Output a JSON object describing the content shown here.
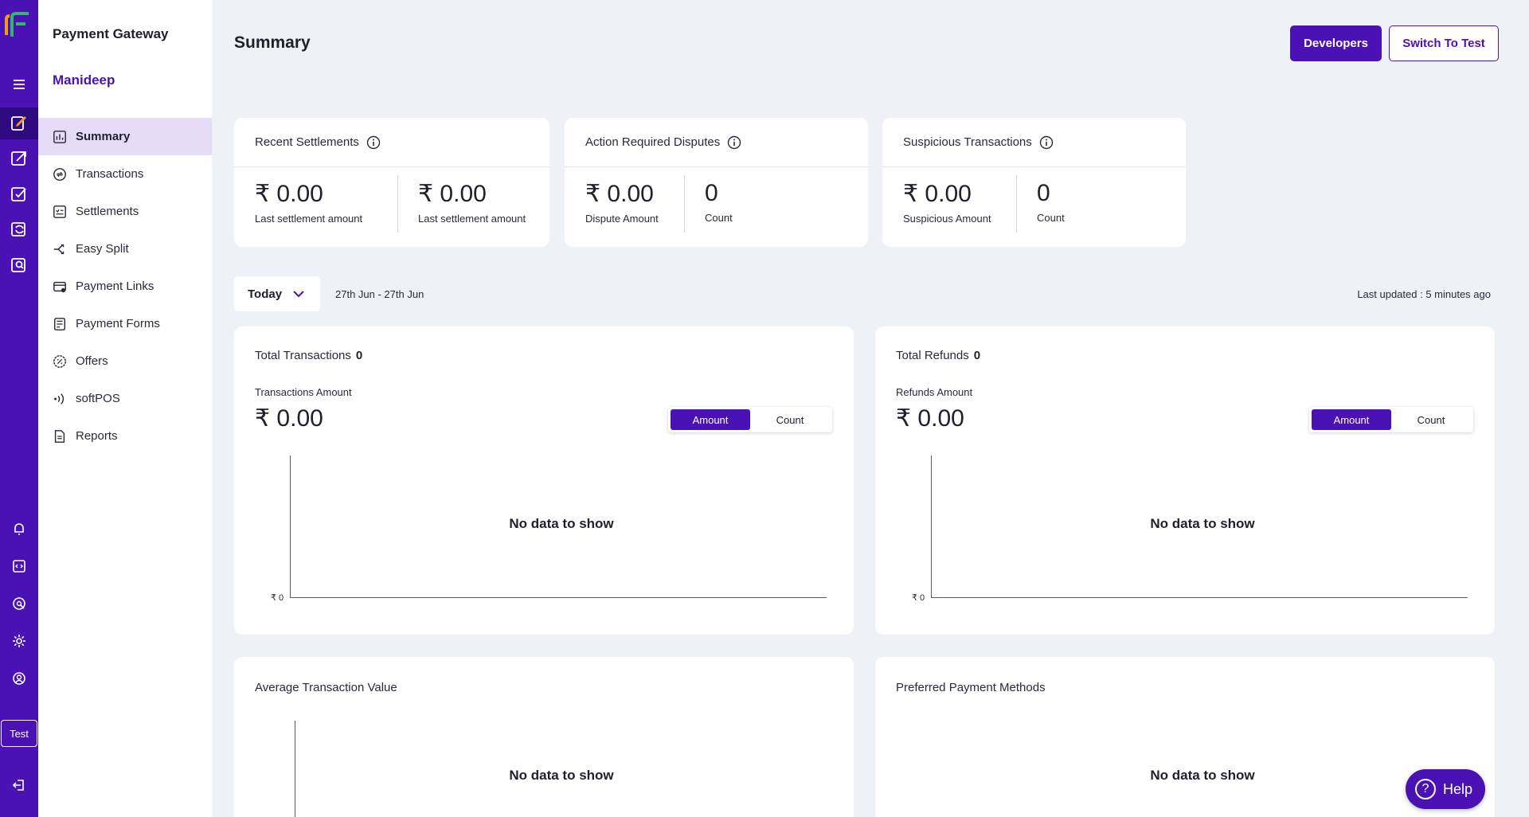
{
  "sidebar": {
    "title": "Payment Gateway",
    "user": "Manideep",
    "items": [
      {
        "label": "Summary",
        "icon": "bar-chart-icon"
      },
      {
        "label": "Transactions",
        "icon": "transactions-icon"
      },
      {
        "label": "Settlements",
        "icon": "settlements-icon"
      },
      {
        "label": "Easy Split",
        "icon": "split-icon"
      },
      {
        "label": "Payment Links",
        "icon": "card-link-icon"
      },
      {
        "label": "Payment Forms",
        "icon": "form-icon"
      },
      {
        "label": "Offers",
        "icon": "offer-badge-icon"
      },
      {
        "label": "softPOS",
        "icon": "nfc-icon"
      },
      {
        "label": "Reports",
        "icon": "document-icon"
      }
    ]
  },
  "rail": {
    "test_label": "Test"
  },
  "header": {
    "title": "Summary",
    "developers_label": "Developers",
    "switch_label": "Switch To Test"
  },
  "stats": {
    "settlements": {
      "title": "Recent Settlements",
      "cells": [
        {
          "value": "₹ 0.00",
          "label": "Last settlement amount"
        },
        {
          "value": "₹ 0.00",
          "label": "Last settlement amount"
        }
      ]
    },
    "disputes": {
      "title": "Action Required Disputes",
      "cells": [
        {
          "value": "₹ 0.00",
          "label": "Dispute Amount"
        },
        {
          "value": "0",
          "label": "Count"
        }
      ]
    },
    "suspicious": {
      "title": "Suspicious Transactions",
      "cells": [
        {
          "value": "₹ 0.00",
          "label": "Suspicious Amount"
        },
        {
          "value": "0",
          "label": "Count"
        }
      ]
    }
  },
  "filter": {
    "period": "Today",
    "date_range": "27th Jun - 27th Jun",
    "last_updated": "Last updated : 5 minutes ago"
  },
  "charts": {
    "transactions": {
      "title": "Total Transactions",
      "total": "0",
      "sub": "Transactions Amount",
      "amount": "₹ 0.00",
      "toggle_on": "Amount",
      "toggle_off": "Count",
      "empty": "No data to show",
      "zero_tick": "₹ 0"
    },
    "refunds": {
      "title": "Total Refunds",
      "total": "0",
      "sub": "Refunds Amount",
      "amount": "₹ 0.00",
      "toggle_on": "Amount",
      "toggle_off": "Count",
      "empty": "No data to show",
      "zero_tick": "₹ 0"
    },
    "average": {
      "title": "Average Transaction Value",
      "empty": "No data to show"
    },
    "methods": {
      "title": "Preferred Payment Methods",
      "empty": "No data to show"
    }
  },
  "help": {
    "label": "Help"
  },
  "colors": {
    "brand": "#4a12b5",
    "active_nav": "#e7dcf8",
    "background": "#eef1f5"
  }
}
